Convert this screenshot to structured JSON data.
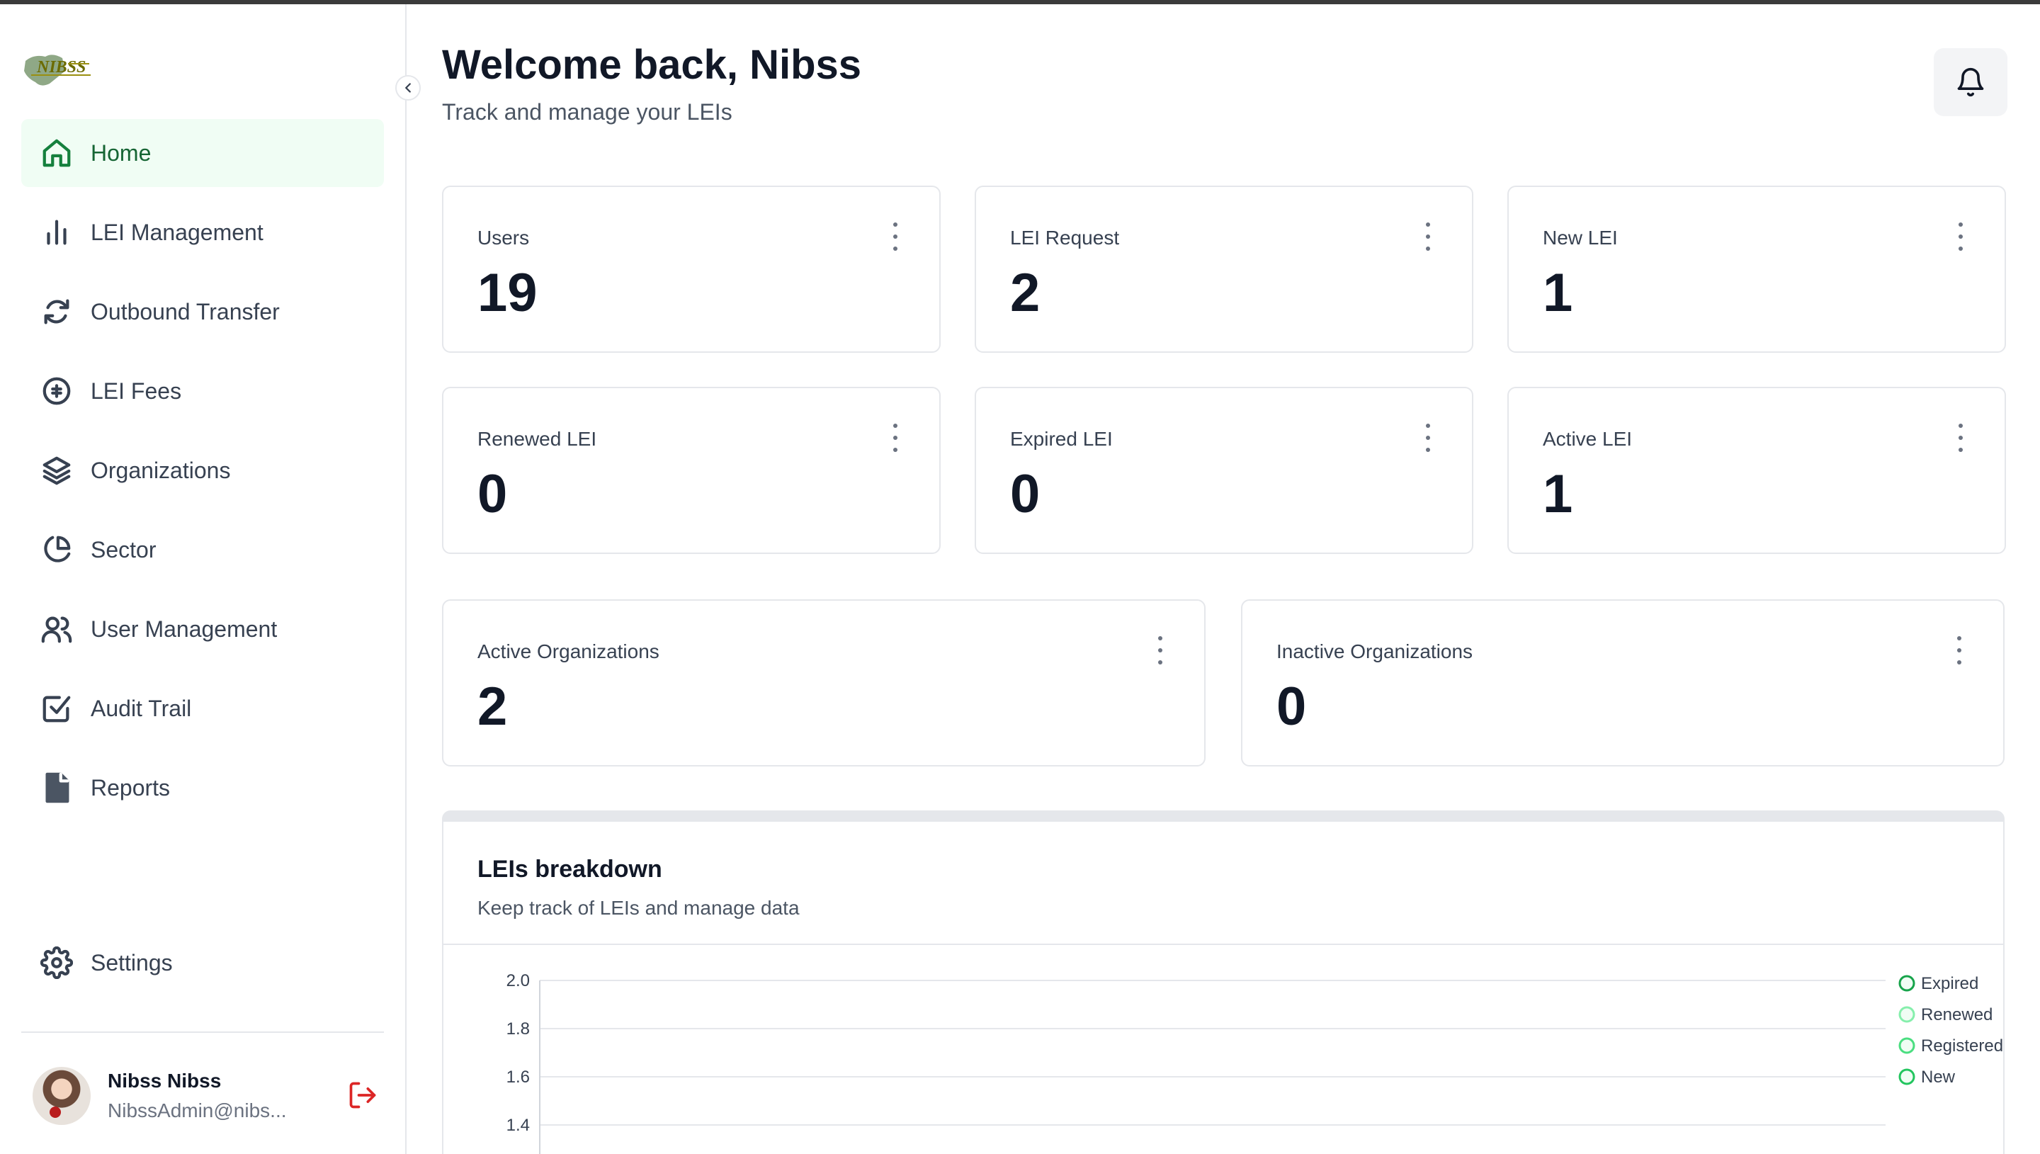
{
  "sidebar": {
    "brand": "NIBSS",
    "items": [
      {
        "label": "Home",
        "icon": "home-icon",
        "active": true
      },
      {
        "label": "LEI Management",
        "icon": "bar-chart-icon",
        "active": false
      },
      {
        "label": "Outbound Transfer",
        "icon": "refresh-icon",
        "active": false
      },
      {
        "label": "LEI Fees",
        "icon": "coin-icon",
        "active": false
      },
      {
        "label": "Organizations",
        "icon": "layers-icon",
        "active": false
      },
      {
        "label": "Sector",
        "icon": "pie-chart-icon",
        "active": false
      },
      {
        "label": "User Management",
        "icon": "users-icon",
        "active": false
      },
      {
        "label": "Audit Trail",
        "icon": "check-square-icon",
        "active": false
      },
      {
        "label": "Reports",
        "icon": "file-icon",
        "active": false
      }
    ],
    "settings_label": "Settings",
    "user": {
      "name": "Nibss Nibss",
      "email": "NibssAdmin@nibs..."
    }
  },
  "header": {
    "title": "Welcome back, Nibss",
    "subtitle": "Track and manage your LEIs"
  },
  "stats": [
    {
      "label": "Users",
      "value": "19"
    },
    {
      "label": "LEI Request",
      "value": "2"
    },
    {
      "label": "New LEI",
      "value": "1"
    },
    {
      "label": "Renewed LEI",
      "value": "0"
    },
    {
      "label": "Expired LEI",
      "value": "0"
    },
    {
      "label": "Active LEI",
      "value": "1"
    }
  ],
  "org_stats": [
    {
      "label": "Active Organizations",
      "value": "2"
    },
    {
      "label": "Inactive Organizations",
      "value": "0"
    }
  ],
  "breakdown": {
    "title": "LEIs breakdown",
    "subtitle": "Keep track of LEIs and manage data"
  },
  "colors": {
    "accent": "#15803d",
    "accent_bg": "#f0fdf4",
    "logout": "#dc2626"
  },
  "chart_data": {
    "type": "line",
    "y_ticks": [
      "2.0",
      "1.8",
      "1.6",
      "1.4"
    ],
    "ylim": [
      1.4,
      2.0
    ],
    "grid": true,
    "legend_position": "right",
    "series": [
      {
        "name": "Expired",
        "color": "#16a34a"
      },
      {
        "name": "Renewed",
        "color": "#86efac"
      },
      {
        "name": "Registered",
        "color": "#4ade80"
      },
      {
        "name": "New",
        "color": "#22c55e"
      }
    ]
  }
}
